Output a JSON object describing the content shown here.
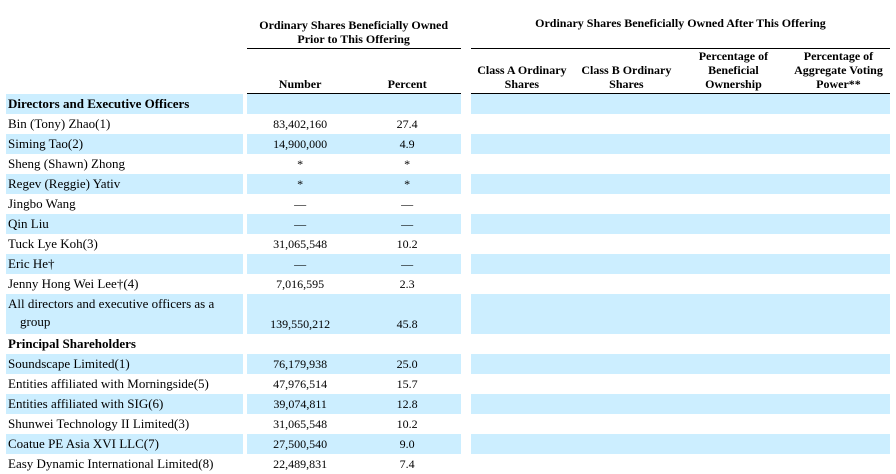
{
  "header": {
    "prior_group": "Ordinary Shares Beneficially Owned Prior to This Offering",
    "after_group": "Ordinary Shares Beneficially Owned After This Offering",
    "col_number": "Number",
    "col_percent": "Percent",
    "col_class_a": "Class A Ordinary Shares",
    "col_class_b": "Class B Ordinary Shares",
    "col_pct_ownership": "Percentage of Beneficial Ownership",
    "col_pct_voting": "Percentage of Aggregate Voting Power**"
  },
  "sections": {
    "directors": "Directors and Executive Officers",
    "principal": "Principal Shareholders"
  },
  "directors": [
    {
      "name": "Bin (Tony) Zhao(1)",
      "number": "83,402,160",
      "percent": "27.4"
    },
    {
      "name": "Siming Tao(2)",
      "number": "14,900,000",
      "percent": "4.9"
    },
    {
      "name": "Sheng (Shawn) Zhong",
      "number": "*",
      "percent": "*"
    },
    {
      "name": "Regev (Reggie) Yativ",
      "number": "*",
      "percent": "*"
    },
    {
      "name": "Jingbo Wang",
      "number": "—",
      "percent": "—"
    },
    {
      "name": "Qin Liu",
      "number": "—",
      "percent": "—"
    },
    {
      "name": "Tuck Lye Koh(3)",
      "number": "31,065,548",
      "percent": "10.2"
    },
    {
      "name": "Eric He†",
      "number": "—",
      "percent": "—"
    },
    {
      "name": "Jenny Hong Wei Lee†(4)",
      "number": "7,016,595",
      "percent": "2.3"
    }
  ],
  "all_directors": {
    "name_line1": "All directors and executive officers as a",
    "name_line2": "group",
    "number": "139,550,212",
    "percent": "45.8"
  },
  "principal": [
    {
      "name": "Soundscape Limited(1)",
      "number": "76,179,938",
      "percent": "25.0"
    },
    {
      "name": "Entities affiliated with Morningside(5)",
      "number": "47,976,514",
      "percent": "15.7"
    },
    {
      "name": "Entities affiliated with SIG(6)",
      "number": "39,074,811",
      "percent": "12.8"
    },
    {
      "name": "Shunwei Technology II Limited(3)",
      "number": "31,065,548",
      "percent": "10.2"
    },
    {
      "name": "Coatue PE Asia XVI LLC(7)",
      "number": "27,500,540",
      "percent": "9.0"
    },
    {
      "name": "Easy Dynamic International Limited(8)",
      "number": "22,489,831",
      "percent": "7.4"
    }
  ]
}
